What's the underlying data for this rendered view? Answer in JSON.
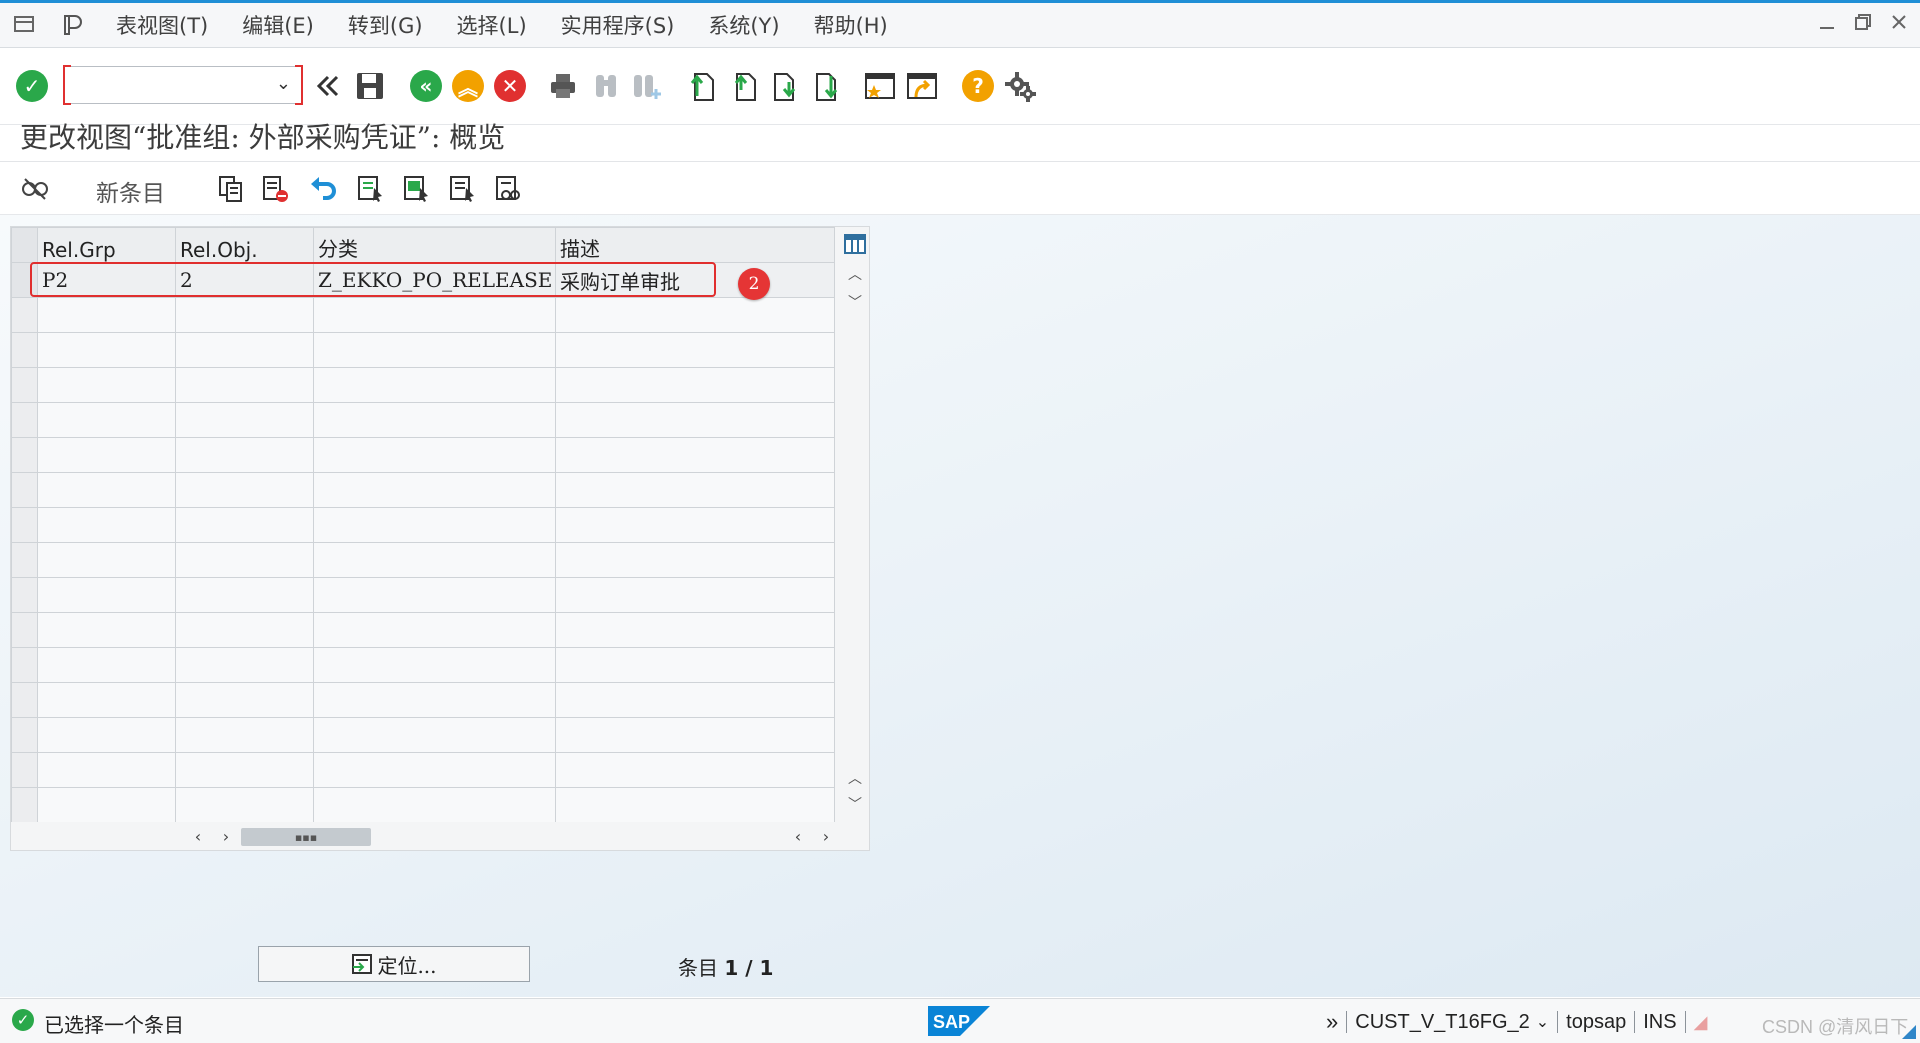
{
  "menu": {
    "items": [
      "表视图(T)",
      "编辑(E)",
      "转到(G)",
      "选择(L)",
      "实用程序(S)",
      "系统(Y)",
      "帮助(H)"
    ]
  },
  "toolbar": {
    "command_value": "",
    "icons": [
      "enter-check",
      "command-field",
      "back-double",
      "save",
      "back",
      "exit",
      "cancel",
      "print",
      "find",
      "find-next",
      "first-page",
      "previous-page",
      "next-page",
      "last-page",
      "new-session",
      "shortcut",
      "help",
      "customize"
    ]
  },
  "page": {
    "title": "更改视图“批准组: 外部采购凭证”: 概览"
  },
  "app_toolbar": {
    "new_entries": "新条目"
  },
  "table": {
    "columns": [
      "Rel.Grp",
      "Rel.Obj.",
      "分类",
      "描述"
    ],
    "rows": [
      [
        "P2",
        "2",
        "Z_EKKO_PO_RELEASE",
        "采购订单审批"
      ]
    ],
    "empty_rows": 15
  },
  "annotation": {
    "marker": "2"
  },
  "footer": {
    "locate_label": "定位...",
    "entry_label": "条目",
    "entry_value": "1 / 1"
  },
  "status": {
    "message": "已选择一个条目",
    "chevron": "»",
    "transaction": "CUST_V_T16FG_2",
    "server": "topsap",
    "mode": "INS",
    "watermark": "CSDN @清风日下"
  },
  "colors": {
    "accent_blue": "#1f8fd6",
    "ok_green": "#2aa84a",
    "cancel_red": "#e03030",
    "nav_orange": "#f2a100",
    "highlight_red": "#e02e2e"
  }
}
